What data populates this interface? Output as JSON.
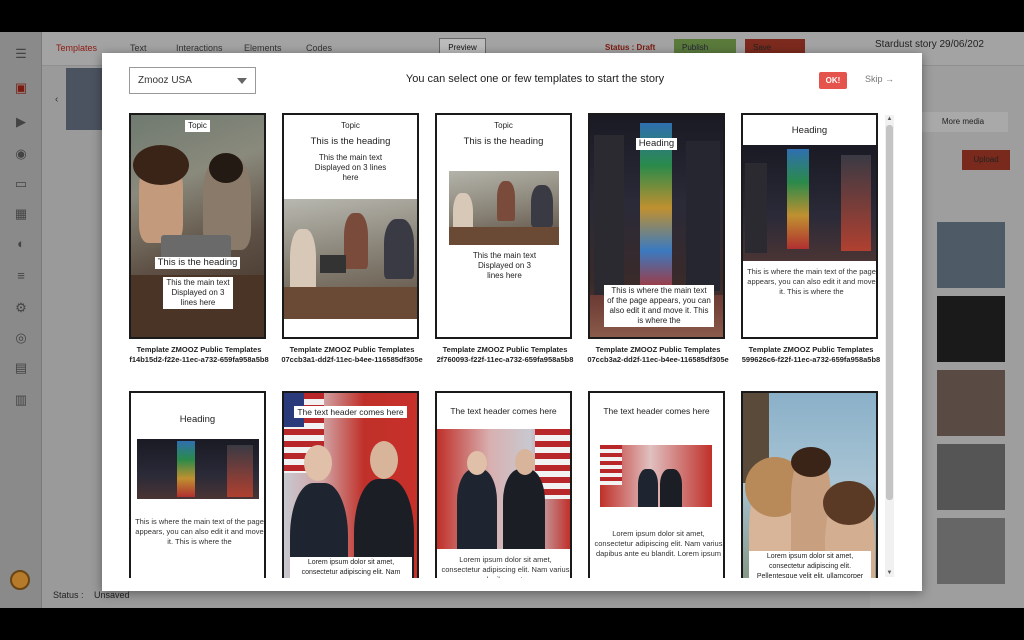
{
  "app": {
    "nav_tabs": [
      "Templates",
      "Text",
      "Interactions",
      "Elements",
      "Codes"
    ],
    "preview_label": "Preview",
    "status_draft": "Status : Draft",
    "publish_label": "Publish",
    "save_label": "Save",
    "story_title": "Stardust story 29/06/202",
    "more_media_label": "More media",
    "upload_label": "Upload",
    "status_label": "Status :",
    "status_value": "Unsaved"
  },
  "modal": {
    "account": "Zmooz USA",
    "title": "You can select one or few templates to start the story",
    "ok_label": "OK!",
    "skip_label": "Skip →"
  },
  "templates": [
    {
      "caption": "Template ZMOOZ Public Templates f14b15d2-f22e-11ec-a732-659fa958a5b8",
      "topic": "Topic",
      "heading": "This is the heading",
      "text": "This the main text Displayed on 3 lines here"
    },
    {
      "caption": "Template ZMOOZ Public Templates 07ccb3a1-dd2f-11ec-b4ee-116585df305e",
      "topic": "Topic",
      "heading": "This is the heading",
      "text": "This the main text Displayed on 3 lines here"
    },
    {
      "caption": "Template ZMOOZ Public Templates 2f760093-f22f-11ec-a732-659fa958a5b8",
      "topic": "Topic",
      "heading": "This is the heading",
      "text": "This the main text Displayed on 3 lines here"
    },
    {
      "caption": "Template ZMOOZ Public Templates 07ccb3a2-dd2f-11ec-b4ee-116585df305e",
      "heading": "Heading",
      "text": "This is where the main text of the page appears, you can also edit it and move it. This is where the"
    },
    {
      "caption": "Template ZMOOZ Public Templates 599626c6-f22f-11ec-a732-659fa958a5b8",
      "heading": "Heading",
      "text": "This is where the main text of the page appears, you can also edit it and move it. This is where the"
    },
    {
      "heading": "Heading",
      "text": "This is where the main text of the page appears, you can also edit it and move it. This is where the"
    },
    {
      "heading": "The text header comes here",
      "text": "Lorem ipsum dolor sit amet, consectetur adipiscing elit. Nam varius dapibus ante"
    },
    {
      "heading": "The text header comes here",
      "text": "Lorem ipsum dolor sit amet, consectetur adipiscing elit. Nam varius dapibus ante"
    },
    {
      "heading": "The text header comes here",
      "text": "Lorem ipsum dolor sit amet, consectetur adipiscing elit. Nam varius dapibus ante eu blandit. Lorem ipsum"
    },
    {
      "text": "Lorem ipsum dolor sit amet, consectetur adipiscing elit. Pellentesque velit elit, ullamcorper hendrerit justo eget,"
    }
  ],
  "colors": {
    "ok_button": "#e4534c",
    "card_border": "#1a1a1a",
    "dim_overlay": "#9a9a9a"
  }
}
